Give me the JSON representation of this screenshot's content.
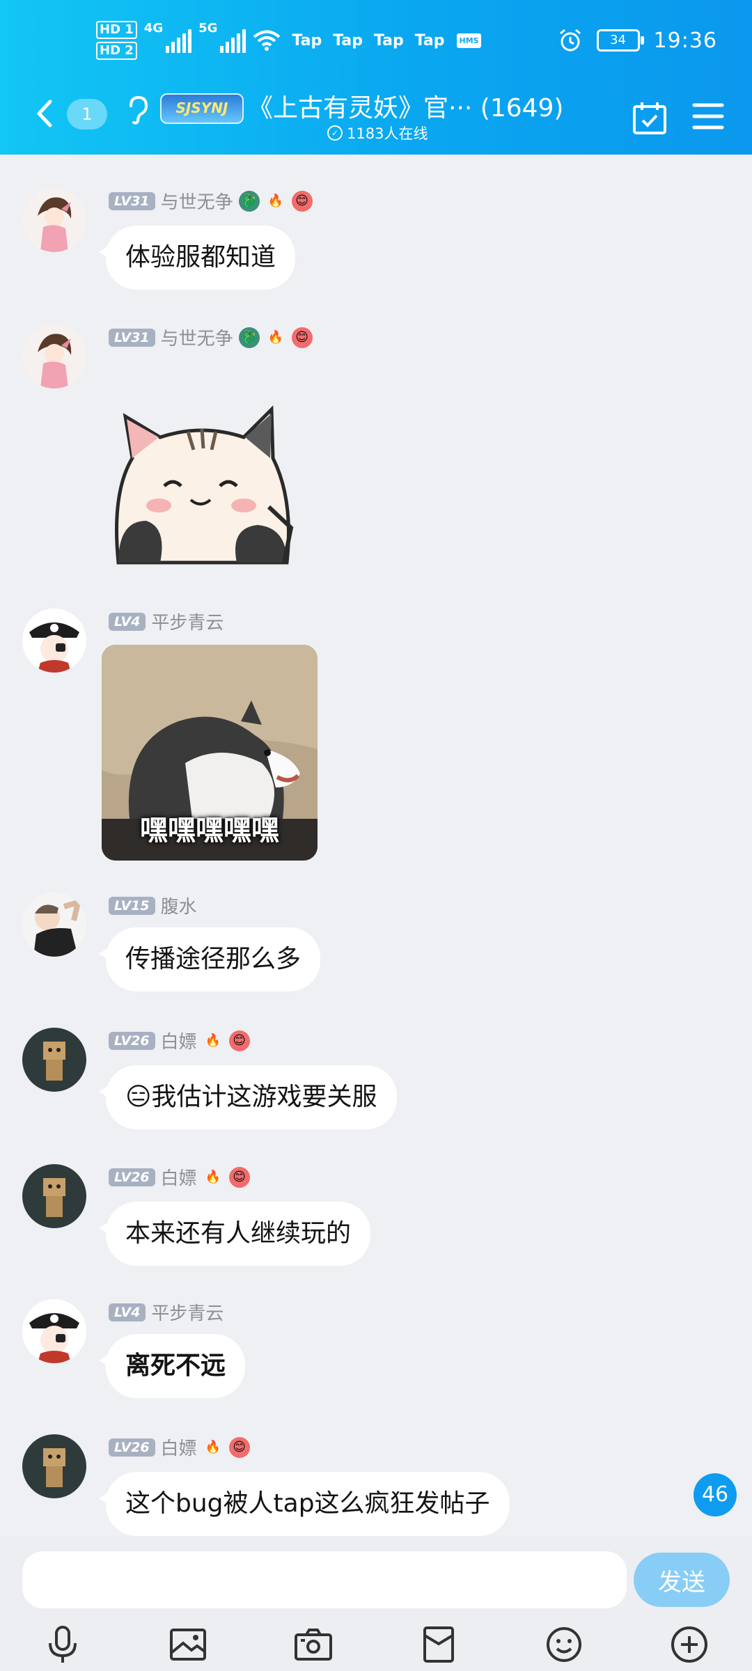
{
  "status_bar": {
    "hd1": "HD 1",
    "hd2": "HD 2",
    "net1": "4G",
    "net2": "5G",
    "tap_notifications": [
      "Tap",
      "Tap",
      "Tap",
      "Tap"
    ],
    "hms_label": "HMS",
    "battery": "34",
    "time": "19:36"
  },
  "nav": {
    "unread_count": "1",
    "group_logo_text": "SJSYNJ",
    "title": "《上古有灵妖》官··· (1649)",
    "online": "1183人在线"
  },
  "messages": [
    {
      "level": "LV31",
      "name": "与世无争",
      "text": "体验服都知道"
    },
    {
      "level": "LV31",
      "name": "与世无争",
      "sticker": "cat-sticker"
    },
    {
      "level": "LV4",
      "name": "平步青云",
      "sticker": "husky-meme",
      "sticker_caption": "嘿嘿嘿嘿嘿"
    },
    {
      "level": "LV15",
      "name": "腹水",
      "text": "传播途径那么多"
    },
    {
      "level": "LV26",
      "name": "白嫖",
      "text": "😑我估计这游戏要关服"
    },
    {
      "level": "LV26",
      "name": "白嫖",
      "text": "本来还有人继续玩的"
    },
    {
      "level": "LV4",
      "name": "平步青云",
      "text": "离死不远"
    },
    {
      "level": "LV26",
      "name": "白嫖",
      "text": "这个bug被人tap这么疯狂发帖子"
    }
  ],
  "floating_unread": "46",
  "composer": {
    "placeholder": "",
    "send_label": "发送"
  },
  "toolbar_icons": [
    "microphone-icon",
    "photo-icon",
    "camera-icon",
    "red-packet-icon",
    "emoji-icon",
    "plus-icon"
  ],
  "colors": {
    "header_gradient_start": "#12c6f5",
    "header_gradient_end": "#0b98ee",
    "send_button": "#88cdf6",
    "level_badge": "#a8b1c2"
  }
}
